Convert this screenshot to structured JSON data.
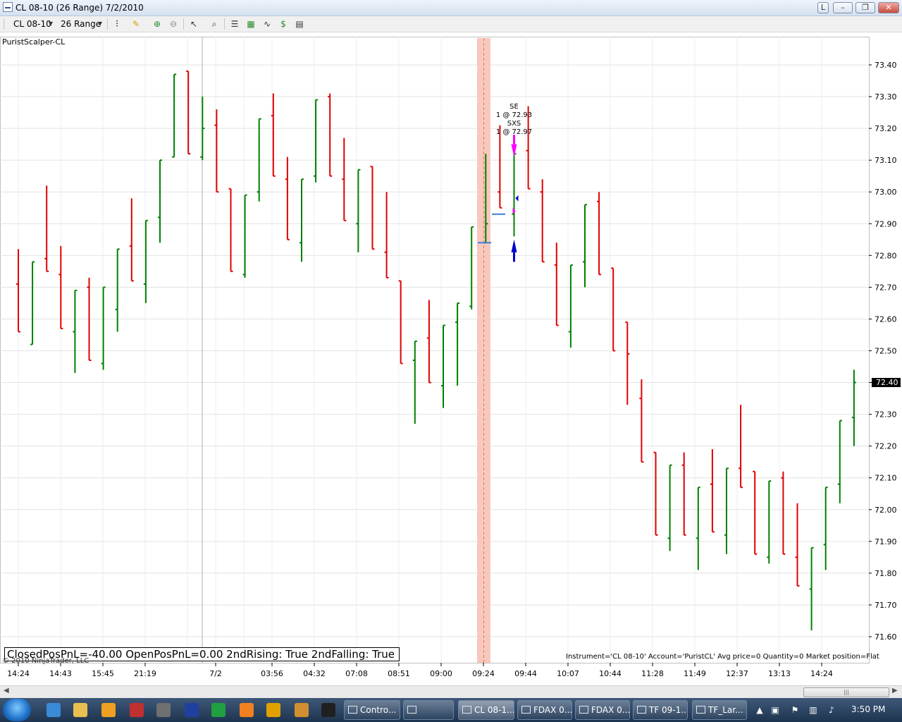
{
  "window": {
    "title": "CL 08-10 (26 Range)  7/2/2010",
    "buttons": [
      "L",
      "–",
      "❐",
      "✕"
    ]
  },
  "toolbar": {
    "instrument": "CL 08-10",
    "interval": "26 Range"
  },
  "chart": {
    "strategy_label": "PuristScalper-CL",
    "status_text": "ClosedPosPnL=-40.00 OpenPosPnL=0.00 2ndRising: True 2ndFalling: True",
    "copyright": "© 2010 NinjaTrader, LLC",
    "info_line": "Instrument='CL 08-10' Account='PuristCL' Avg price=0 Quantity=0 Market position=Flat",
    "current_price": "72.40",
    "price_ticks": [
      "73.40",
      "73.30",
      "73.20",
      "73.10",
      "73.00",
      "72.90",
      "72.80",
      "72.70",
      "72.60",
      "72.50",
      "72.40",
      "72.30",
      "72.20",
      "72.10",
      "72.00",
      "71.90",
      "71.80",
      "71.70",
      "71.60"
    ],
    "time_ticks": [
      "14:24",
      "14:43",
      "15:45",
      "21:19",
      "7/2",
      "03:56",
      "04:32",
      "07:08",
      "08:51",
      "09:00",
      "09:24",
      "09:44",
      "10:07",
      "10:44",
      "11:28",
      "11:49",
      "12:37",
      "13:13",
      "14:24"
    ],
    "trade_annotation": [
      "SE",
      "1 @ 72.93",
      "SXS",
      "1 @ 72.97"
    ],
    "colors": {
      "up": "#008000",
      "down": "#e00000",
      "highlight": "#f8c8c0",
      "marker_pink": "#ff00ff",
      "marker_blue": "#0000cc"
    }
  },
  "chart_data": {
    "type": "ohlc",
    "ylim": [
      71.55,
      73.5
    ],
    "bars": [
      {
        "o": 72.71,
        "h": 72.82,
        "l": 72.56,
        "c": 72.56
      },
      {
        "o": 72.52,
        "h": 72.78,
        "l": 72.52,
        "c": 72.78
      },
      {
        "o": 72.79,
        "h": 73.02,
        "l": 72.75,
        "c": 72.75
      },
      {
        "o": 72.74,
        "h": 72.83,
        "l": 72.57,
        "c": 72.57
      },
      {
        "o": 72.56,
        "h": 72.69,
        "l": 72.43,
        "c": 72.69
      },
      {
        "o": 72.7,
        "h": 72.73,
        "l": 72.47,
        "c": 72.47
      },
      {
        "o": 72.46,
        "h": 72.7,
        "l": 72.44,
        "c": 72.7
      },
      {
        "o": 72.63,
        "h": 72.82,
        "l": 72.56,
        "c": 72.82
      },
      {
        "o": 72.83,
        "h": 72.98,
        "l": 72.72,
        "c": 72.72
      },
      {
        "o": 72.71,
        "h": 72.91,
        "l": 72.65,
        "c": 72.91
      },
      {
        "o": 72.92,
        "h": 73.1,
        "l": 72.84,
        "c": 73.1
      },
      {
        "o": 73.11,
        "h": 73.37,
        "l": 73.11,
        "c": 73.37
      },
      {
        "o": 73.38,
        "h": 73.38,
        "l": 73.12,
        "c": 73.12
      },
      {
        "o": 73.11,
        "h": 73.3,
        "l": 73.1,
        "c": 73.2
      },
      {
        "o": 73.21,
        "h": 73.26,
        "l": 73.0,
        "c": 73.0
      },
      {
        "o": 73.01,
        "h": 73.01,
        "l": 72.75,
        "c": 72.75
      },
      {
        "o": 72.74,
        "h": 72.99,
        "l": 72.73,
        "c": 72.99
      },
      {
        "o": 73.0,
        "h": 73.23,
        "l": 72.97,
        "c": 73.23
      },
      {
        "o": 73.24,
        "h": 73.31,
        "l": 73.05,
        "c": 73.05
      },
      {
        "o": 73.04,
        "h": 73.11,
        "l": 72.85,
        "c": 72.85
      },
      {
        "o": 72.84,
        "h": 73.04,
        "l": 72.78,
        "c": 73.04
      },
      {
        "o": 73.05,
        "h": 73.29,
        "l": 73.03,
        "c": 73.29
      },
      {
        "o": 73.3,
        "h": 73.31,
        "l": 73.05,
        "c": 73.05
      },
      {
        "o": 73.04,
        "h": 73.17,
        "l": 72.91,
        "c": 72.91
      },
      {
        "o": 72.9,
        "h": 73.07,
        "l": 72.81,
        "c": 73.07
      },
      {
        "o": 73.08,
        "h": 73.08,
        "l": 72.82,
        "c": 72.82
      },
      {
        "o": 72.81,
        "h": 73.0,
        "l": 72.73,
        "c": 72.73
      },
      {
        "o": 72.72,
        "h": 72.72,
        "l": 72.46,
        "c": 72.46
      },
      {
        "o": 72.47,
        "h": 72.53,
        "l": 72.27,
        "c": 72.53
      },
      {
        "o": 72.54,
        "h": 72.66,
        "l": 72.4,
        "c": 72.4
      },
      {
        "o": 72.39,
        "h": 72.58,
        "l": 72.32,
        "c": 72.58
      },
      {
        "o": 72.59,
        "h": 72.65,
        "l": 72.39,
        "c": 72.65
      },
      {
        "o": 72.64,
        "h": 72.89,
        "l": 72.63,
        "c": 72.89
      },
      {
        "o": 72.84,
        "h": 73.12,
        "l": 72.84,
        "c": 72.9
      },
      {
        "o": 73.0,
        "h": 73.21,
        "l": 72.95,
        "c": 72.95
      },
      {
        "o": 72.93,
        "h": 73.12,
        "l": 72.86,
        "c": 73.12
      },
      {
        "o": 73.13,
        "h": 73.27,
        "l": 73.01,
        "c": 73.01
      },
      {
        "o": 73.0,
        "h": 73.04,
        "l": 72.78,
        "c": 72.78
      },
      {
        "o": 72.77,
        "h": 72.84,
        "l": 72.58,
        "c": 72.58
      },
      {
        "o": 72.56,
        "h": 72.77,
        "l": 72.51,
        "c": 72.77
      },
      {
        "o": 72.78,
        "h": 72.96,
        "l": 72.7,
        "c": 72.96
      },
      {
        "o": 72.97,
        "h": 73.0,
        "l": 72.74,
        "c": 72.74
      },
      {
        "o": 72.76,
        "h": 72.76,
        "l": 72.5,
        "c": 72.5
      },
      {
        "o": 72.59,
        "h": 72.59,
        "l": 72.33,
        "c": 72.49
      },
      {
        "o": 72.35,
        "h": 72.41,
        "l": 72.15,
        "c": 72.15
      },
      {
        "o": 72.18,
        "h": 72.18,
        "l": 71.92,
        "c": 71.92
      },
      {
        "o": 71.91,
        "h": 72.14,
        "l": 71.87,
        "c": 72.14
      },
      {
        "o": 72.14,
        "h": 72.18,
        "l": 71.92,
        "c": 71.92
      },
      {
        "o": 71.91,
        "h": 72.07,
        "l": 71.81,
        "c": 72.07
      },
      {
        "o": 72.08,
        "h": 72.19,
        "l": 71.93,
        "c": 71.93
      },
      {
        "o": 71.92,
        "h": 72.13,
        "l": 71.86,
        "c": 72.13
      },
      {
        "o": 72.13,
        "h": 72.33,
        "l": 72.07,
        "c": 72.07
      },
      {
        "o": 72.12,
        "h": 72.12,
        "l": 71.86,
        "c": 71.86
      },
      {
        "o": 71.85,
        "h": 72.09,
        "l": 71.83,
        "c": 72.09
      },
      {
        "o": 72.1,
        "h": 72.12,
        "l": 71.86,
        "c": 71.86
      },
      {
        "o": 71.85,
        "h": 72.02,
        "l": 71.76,
        "c": 71.76
      },
      {
        "o": 71.75,
        "h": 71.88,
        "l": 71.62,
        "c": 71.88
      },
      {
        "o": 71.89,
        "h": 72.07,
        "l": 71.81,
        "c": 72.07
      },
      {
        "o": 72.08,
        "h": 72.28,
        "l": 72.02,
        "c": 72.28
      },
      {
        "o": 72.29,
        "h": 72.44,
        "l": 72.2,
        "c": 72.4
      }
    ]
  }
}
